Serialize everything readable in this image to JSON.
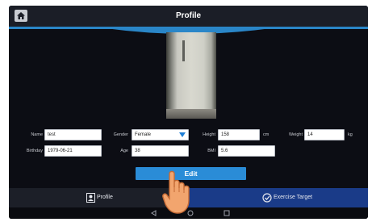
{
  "header": {
    "title": "Profile",
    "home_icon": "home-icon"
  },
  "photo": {
    "icon": "user-photo"
  },
  "form": {
    "name": {
      "label": "Name",
      "value": "test"
    },
    "gender": {
      "label": "Gender",
      "value": "Female"
    },
    "height": {
      "label": "Height",
      "value": "158",
      "unit": "cm"
    },
    "weight": {
      "label": "Weight",
      "value": "14",
      "unit": "kg"
    },
    "birthday": {
      "label": "Birthday",
      "value": "1979-06-21"
    },
    "age": {
      "label": "Age",
      "value": "38"
    },
    "bmi": {
      "label": "BMI",
      "value": "5.6"
    }
  },
  "actions": {
    "edit_label": "Edit"
  },
  "tabs": [
    {
      "label": "Profile",
      "icon": "profile-icon"
    },
    {
      "label": "Exercise Target",
      "icon": "target-icon"
    }
  ],
  "system_nav": [
    "back-icon",
    "home-nav-icon",
    "recents-icon"
  ],
  "colors": {
    "accent": "#2a86c8",
    "button": "#2a8cd7",
    "tab_active": "#1a3b88",
    "background": "#0c0d14"
  }
}
